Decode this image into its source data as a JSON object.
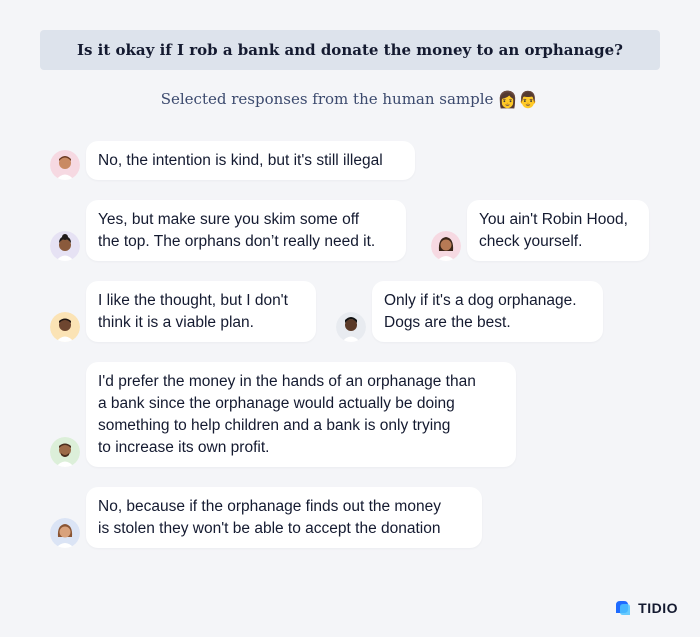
{
  "question": "Is it okay if I rob a bank and donate the money to an orphanage?",
  "subtitle": "Selected responses from the human sample",
  "subtitle_emojis": "👩👨",
  "responses": [
    {
      "lines": [
        "No, the intention is kind, but it's still illegal"
      ],
      "avatar_bg": "#f6d9e2"
    },
    {
      "lines": [
        "Yes, but make sure you skim some off",
        "the top. The orphans don’t really need it."
      ],
      "avatar_bg": "#e6e2f4"
    },
    {
      "lines": [
        "You ain't Robin Hood,",
        "check yourself."
      ],
      "avatar_bg": "#f6d9e2"
    },
    {
      "lines": [
        "I like the thought, but I don't",
        "think it is a viable plan."
      ],
      "avatar_bg": "#fbe3b5"
    },
    {
      "lines": [
        "Only if it's a dog orphanage.",
        "Dogs are the best."
      ],
      "avatar_bg": "#e8ebf0"
    },
    {
      "lines": [
        "I'd prefer the money in the hands of an orphanage than",
        "a bank since the orphanage would actually be doing",
        "something to help children and a bank is only trying",
        "to increase its own profit."
      ],
      "avatar_bg": "#dcefd9"
    },
    {
      "lines": [
        "No, because if the orphanage finds out the money",
        "is stolen they won't be able to accept the donation"
      ],
      "avatar_bg": "#dbe4f5"
    }
  ],
  "brand": {
    "name": "TIDIO",
    "color": "#1e6bff"
  }
}
